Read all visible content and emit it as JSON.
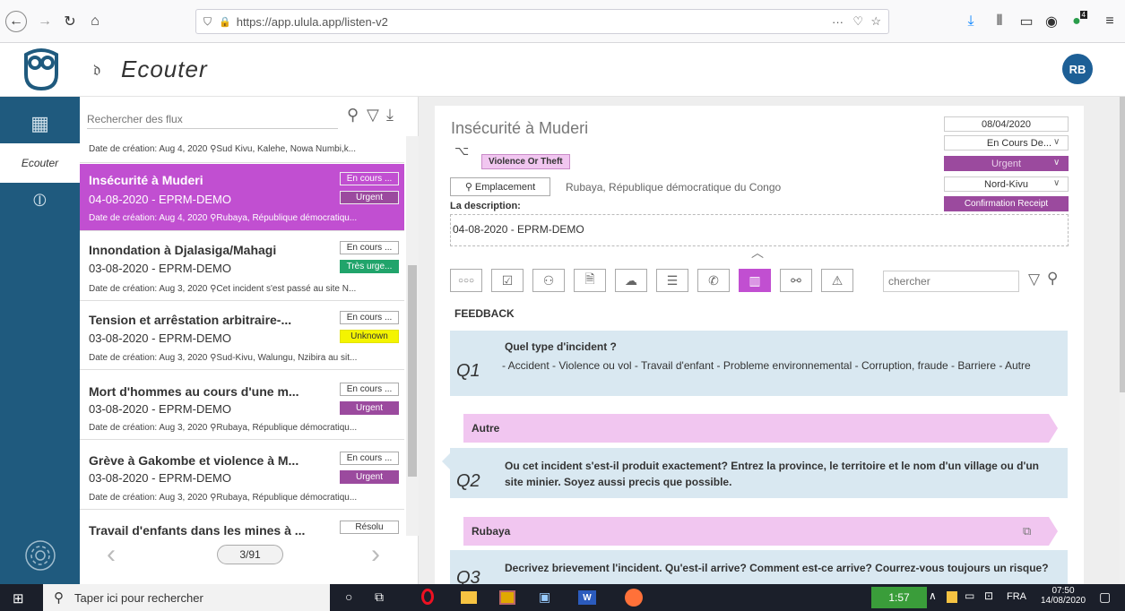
{
  "browser": {
    "url": "https://app.ulula.app/listen-v2",
    "url_host": "app.ulula.app",
    "menu_dots": "···",
    "ext_badge": "4"
  },
  "header": {
    "title": "Ecouter",
    "avatar": "RB"
  },
  "sidebar": {
    "items": [
      {
        "icon": "dashboard-icon"
      },
      {
        "label": "Ecouter"
      },
      {
        "icon": "broadcast-icon"
      }
    ]
  },
  "list": {
    "search_placeholder": "Rechercher des flux",
    "top_partial": "Date de création: Aug 4, 2020  ⚲Sud Kivu, Kalehe, Nowa Numbi,k...",
    "cards": [
      {
        "title": "Insécurité à Muderi",
        "sub": "04-08-2020 - EPRM-DEMO",
        "date": "Date de création: Aug 4, 2020  ⚲Rubaya, République démocratiqu...",
        "status": "En cours ...",
        "priority": "Urgent"
      },
      {
        "title": "Innondation à Djalasiga/Mahagi",
        "sub": "03-08-2020 - EPRM-DEMO",
        "date": "Date de création: Aug 3, 2020  ⚲Cet incident s'est passé au site N...",
        "status": "En cours ...",
        "priority": "Très urge..."
      },
      {
        "title": "Tension et arrêstation arbitraire-...",
        "sub": "03-08-2020 - EPRM-DEMO",
        "date": "Date de création: Aug 3, 2020  ⚲Sud-Kivu, Walungu, Nzibira au sit...",
        "status": "En cours ...",
        "priority": "Unknown"
      },
      {
        "title": "Mort d'hommes au cours d'une m...",
        "sub": "03-08-2020 - EPRM-DEMO",
        "date": "Date de création: Aug 3, 2020  ⚲Rubaya, République démocratiqu...",
        "status": "En cours ...",
        "priority": "Urgent"
      },
      {
        "title": "Grève à Gakombe et violence à M...",
        "sub": "03-08-2020 - EPRM-DEMO",
        "date": "Date de création: Aug 3, 2020  ⚲Rubaya, République démocratiqu...",
        "status": "En cours ...",
        "priority": "Urgent"
      },
      {
        "title": "Travail d'enfants dans les mines à ...",
        "status": "Résolu"
      }
    ],
    "pagination": "3/91"
  },
  "detail": {
    "title": "Insécurité à Muderi",
    "category": "Violence Or Theft",
    "location_btn": "Emplacement",
    "location": "Rubaya, République démocratique du Congo",
    "desc_label": "La description:",
    "desc": "04-08-2020 - EPRM-DEMO",
    "date": "08/04/2020",
    "status": "En Cours De...",
    "priority": "Urgent",
    "region": "Nord-Kivu",
    "confirm": "Confirmation Receipt",
    "search_placeholder": "chercher",
    "feedback": "FEEDBACK",
    "q1": {
      "num": "Q1",
      "question": "Quel type d'incident ?",
      "options": "- Accident  - Violence ou vol  - Travail d'enfant  - Probleme environnemental  - Corruption, fraude  - Barriere  - Autre"
    },
    "a1": "Autre",
    "q2": {
      "num": "Q2",
      "question": "Ou cet incident s'est-il produit exactement? Entrez la province, le territoire et le nom d'un village ou d'un site minier. Soyez aussi precis que possible."
    },
    "a2": "Rubaya",
    "q3": {
      "num": "Q3",
      "question": "Decrivez brievement l'incident. Qu'est-il arrive? Comment est-ce arrive? Courrez-vous toujours un risque?"
    }
  },
  "taskbar": {
    "search": "Taper ici pour rechercher",
    "time": "07:50",
    "date": "14/08/2020",
    "lang": "FRA",
    "clip": "1:57"
  },
  "colors": {
    "sidebar": "#1f5a7e",
    "selected": "#c14fd1",
    "urgent": "#9b4a9e",
    "very_urgent": "#21a46b",
    "unknown": "#f4f400"
  }
}
